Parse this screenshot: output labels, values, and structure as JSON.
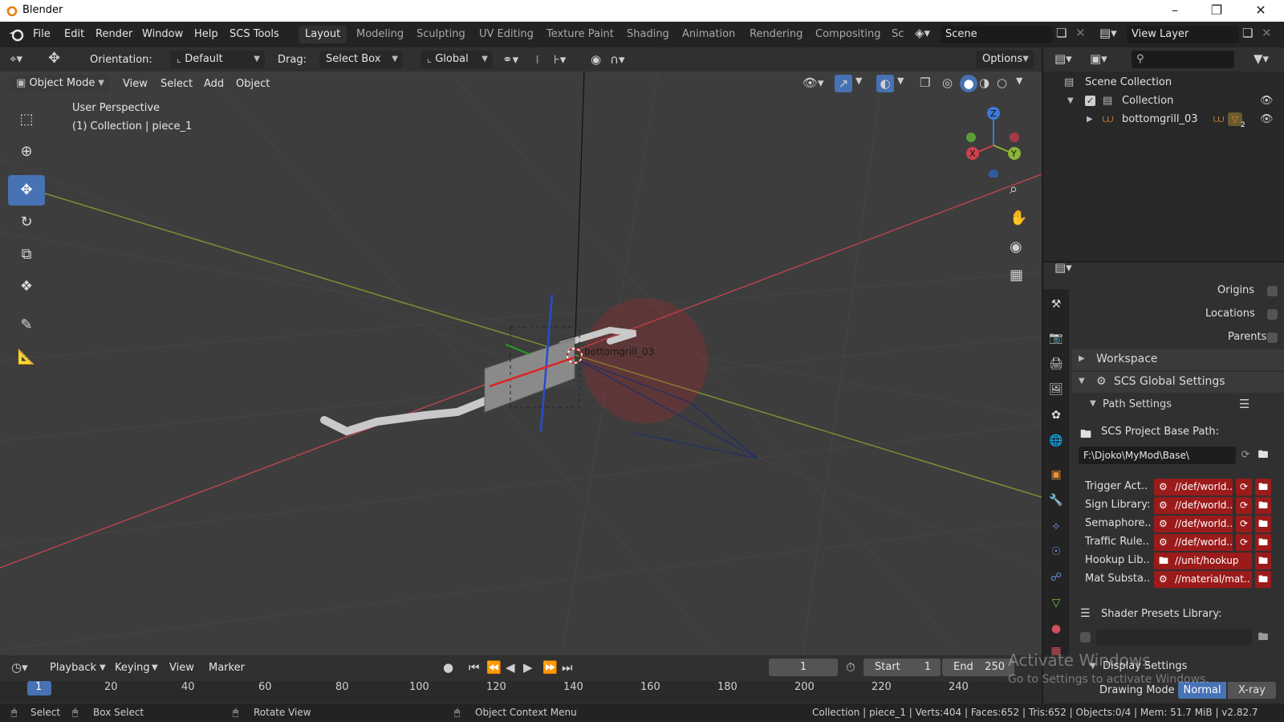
{
  "window": {
    "title": "Blender"
  },
  "menubar": {
    "items": [
      "File",
      "Edit",
      "Render",
      "Window",
      "Help",
      "SCS Tools"
    ],
    "workspaces": [
      "Layout",
      "Modeling",
      "Sculpting",
      "UV Editing",
      "Texture Paint",
      "Shading",
      "Animation",
      "Rendering",
      "Compositing",
      "Sc"
    ],
    "active_workspace": "Layout",
    "scene": "Scene",
    "view_layer": "View Layer"
  },
  "toolheader": {
    "orientation_label": "Orientation:",
    "orientation_value": "Default",
    "drag_label": "Drag:",
    "drag_value": "Select Box",
    "transform_value": "Global",
    "options_label": "Options"
  },
  "viewport": {
    "mode": "Object Mode",
    "menus": [
      "View",
      "Select",
      "Add",
      "Object"
    ],
    "perspective": "User Perspective",
    "context": "(1) Collection | piece_1",
    "object_label": "bottomgrill_03",
    "gizmo_axes": [
      "X",
      "Y",
      "Z"
    ]
  },
  "outliner": {
    "rows": [
      {
        "label": "Scene Collection"
      },
      {
        "label": "Collection"
      },
      {
        "label": "bottomgrill_03",
        "badge": "2"
      }
    ]
  },
  "properties": {
    "overlays": [
      {
        "label": "Origins"
      },
      {
        "label": "Locations"
      },
      {
        "label": "Parents"
      }
    ],
    "workspace_panel": "Workspace",
    "scs_global": "SCS Global Settings",
    "path_settings": "Path Settings",
    "base_path_label": "SCS Project Base Path:",
    "base_path_value": "F:\\Djoko\\MyMod\\Base\\",
    "paths": [
      {
        "label": "Trigger Act..",
        "value": "//def/world.."
      },
      {
        "label": "Sign Library:",
        "value": "//def/world.."
      },
      {
        "label": "Semaphore..",
        "value": "//def/world.."
      },
      {
        "label": "Traffic Rule..",
        "value": "//def/world.."
      },
      {
        "label": "Hookup Lib..",
        "value": "//unit/hookup"
      },
      {
        "label": "Mat Substa..",
        "value": "//material/mat.."
      }
    ],
    "shader_presets_label": "Shader Presets Library:",
    "display_settings": "Display Settings",
    "drawing_mode_label": "Drawing Mode",
    "drawing_modes": [
      "Normal",
      "X-ray"
    ],
    "active_drawing_mode": "Normal"
  },
  "timeline": {
    "menus": [
      "Playback",
      "Keying",
      "View",
      "Marker"
    ],
    "current_frame": "1",
    "start_label": "Start",
    "start_value": "1",
    "end_label": "End",
    "end_value": "250",
    "ticks": [
      "1",
      "20",
      "40",
      "60",
      "80",
      "100",
      "120",
      "140",
      "160",
      "180",
      "200",
      "220",
      "240"
    ]
  },
  "statusbar": {
    "select": "Select",
    "box_select": "Box Select",
    "rotate_view": "Rotate View",
    "context_menu": "Object Context Menu",
    "stats": "Collection | piece_1 | Verts:404 | Faces:652 | Tris:652 | Objects:0/4 | Mem: 51.7 MiB | v2.82.7"
  },
  "watermark": {
    "line1": "Activate Windows",
    "line2": "Go to Settings to activate Windows."
  },
  "colors": {
    "accent": "#4772b3",
    "path_field": "#9b1a1a",
    "x_axis": "#d0404e",
    "y_axis": "#8bb43a",
    "z_axis": "#3a7ad8"
  }
}
